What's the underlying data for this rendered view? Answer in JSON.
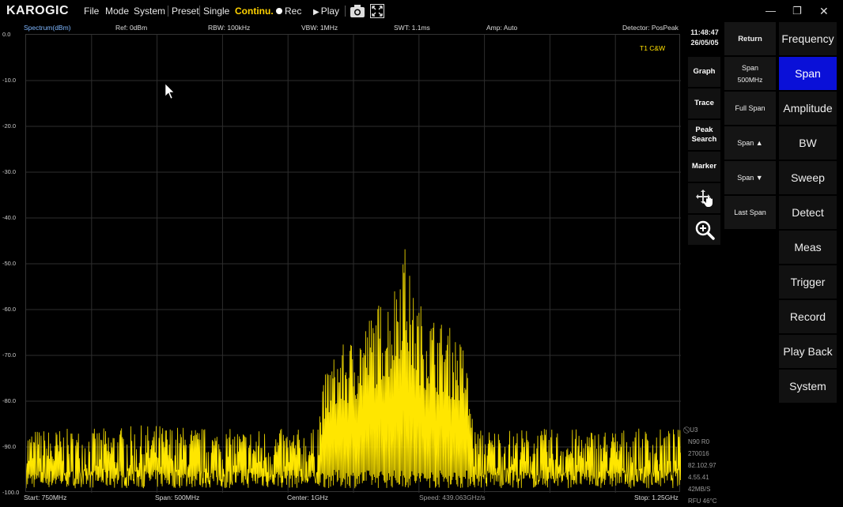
{
  "app": {
    "logo": "KAROGIC",
    "menu": [
      "File",
      "Mode",
      "System",
      "Preset",
      "Single",
      "Continu."
    ],
    "rec_label": "Rec",
    "play_label": "Play"
  },
  "info": {
    "spectrum": "Spectrum(dBm)",
    "ref": "Ref: 0dBm",
    "rbw": "RBW: 100kHz",
    "vbw": "VBW: 1MHz",
    "swt": "SWT: 1.1ms",
    "amp": "Amp: Auto",
    "detector": "Detector: PosPeak"
  },
  "trace_tag": "T1 C&W",
  "y_labels": [
    "0.0",
    "-10.0",
    "-20.0",
    "-30.0",
    "-40.0",
    "-50.0",
    "-60.0",
    "-70.0",
    "-80.0",
    "-90.0",
    "-100.0"
  ],
  "bottom": {
    "start": "Start: 750MHz",
    "span": "Span: 500MHz",
    "center": "Center: 1GHz",
    "speed": "Speed: 439.063GHz/s",
    "stop": "Stop: 1.25GHz"
  },
  "clock": {
    "time": "11:48:47",
    "date": "26/05/05"
  },
  "mid_buttons": [
    "Graph",
    "Trace",
    "Peak Search",
    "Marker"
  ],
  "sub_menu": {
    "return": "Return",
    "span_label": "Span",
    "span_value": "500MHz",
    "full_span": "Full Span",
    "span_up": "Span ▲",
    "span_down": "Span ▼",
    "last_span": "Last Span"
  },
  "main_menu": [
    "Frequency",
    "Span",
    "Amplitude",
    "BW",
    "Sweep",
    "Detect",
    "Meas",
    "Trigger",
    "Record",
    "Play Back",
    "System"
  ],
  "selected_main": "Span",
  "status_lines": [
    "U3",
    "N90 R0",
    "270016",
    "82.102.97",
    "4.55.41",
    "42MB/S",
    "RFU 46°C"
  ],
  "colors": {
    "trace": "#ffe600",
    "selected": "#0a10d8",
    "accent_menu": "#ffd200"
  },
  "chart_data": {
    "type": "line",
    "title": "",
    "xlabel": "",
    "ylabel": "Spectrum(dBm)",
    "x_range": [
      750,
      1250
    ],
    "x_unit": "MHz",
    "ylim": [
      -100,
      0
    ],
    "grid": true,
    "series": [
      {
        "name": "T1 C&W",
        "noise_floor_db": -90,
        "envelope": [
          {
            "x": 750,
            "y": -86
          },
          {
            "x": 800,
            "y": -86
          },
          {
            "x": 850,
            "y": -85
          },
          {
            "x": 900,
            "y": -86
          },
          {
            "x": 970,
            "y": -86
          },
          {
            "x": 980,
            "y": -72
          },
          {
            "x": 990,
            "y": -68
          },
          {
            "x": 1000,
            "y": -66
          },
          {
            "x": 1010,
            "y": -62
          },
          {
            "x": 1020,
            "y": -58
          },
          {
            "x": 1030,
            "y": -56
          },
          {
            "x": 1038,
            "y": -43
          },
          {
            "x": 1045,
            "y": -56
          },
          {
            "x": 1055,
            "y": -60
          },
          {
            "x": 1065,
            "y": -62
          },
          {
            "x": 1075,
            "y": -64
          },
          {
            "x": 1085,
            "y": -68
          },
          {
            "x": 1092,
            "y": -86
          },
          {
            "x": 1150,
            "y": -86
          },
          {
            "x": 1250,
            "y": -86
          }
        ]
      }
    ]
  }
}
